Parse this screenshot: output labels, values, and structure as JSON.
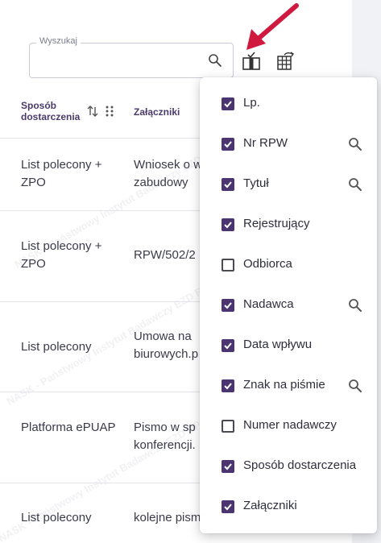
{
  "search": {
    "legend": "Wyszukaj",
    "value": ""
  },
  "toolbar": {
    "columns_icon": "columns-select-icon",
    "export_icon": "export-table-icon"
  },
  "table": {
    "headers": {
      "sposob": "Sposób dostarczenia",
      "zalaczniki": "Załączniki"
    },
    "rows": [
      {
        "sposob": "List polecony + ZPO",
        "zal": "Wniosek o w zabudowy"
      },
      {
        "sposob": "List polecony + ZPO",
        "zal": "RPW/502/2"
      },
      {
        "sposob": "List polecony",
        "zal": "Umowa na biurowych.p"
      },
      {
        "sposob": "Platforma ePUAP",
        "zal": "Pismo w sp konferencji."
      },
      {
        "sposob": "List polecony",
        "zal": "kolejne pism"
      }
    ]
  },
  "watermark": "NASK - Państwowy Instytut Badawczy  EZD RP",
  "columns_menu": {
    "options": [
      {
        "label": "Lp.",
        "checked": true,
        "searchable": false
      },
      {
        "label": "Nr RPW",
        "checked": true,
        "searchable": true
      },
      {
        "label": "Tytuł",
        "checked": true,
        "searchable": true
      },
      {
        "label": "Rejestrujący",
        "checked": true,
        "searchable": false
      },
      {
        "label": "Odbiorca",
        "checked": false,
        "searchable": false
      },
      {
        "label": "Nadawca",
        "checked": true,
        "searchable": true
      },
      {
        "label": "Data wpływu",
        "checked": true,
        "searchable": false
      },
      {
        "label": "Znak na piśmie",
        "checked": true,
        "searchable": true
      },
      {
        "label": "Numer nadawczy",
        "checked": false,
        "searchable": false
      },
      {
        "label": "Sposób dostarczenia",
        "checked": true,
        "searchable": false
      },
      {
        "label": "Załączniki",
        "checked": true,
        "searchable": false
      }
    ]
  },
  "colors": {
    "accent": "#4b3570",
    "arrow": "#d0193f"
  }
}
